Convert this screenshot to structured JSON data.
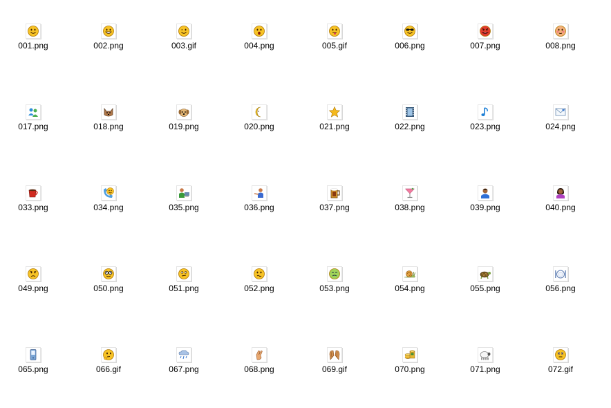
{
  "files": [
    {
      "name": "001.png",
      "icon": "smile-icon"
    },
    {
      "name": "002.png",
      "icon": "grin-icon"
    },
    {
      "name": "003.gif",
      "icon": "wink-icon"
    },
    {
      "name": "004.png",
      "icon": "surprised-icon"
    },
    {
      "name": "005.gif",
      "icon": "tongue-icon"
    },
    {
      "name": "006.png",
      "icon": "sunglasses-icon"
    },
    {
      "name": "007.png",
      "icon": "angry-red-icon"
    },
    {
      "name": "008.png",
      "icon": "blush-icon"
    },
    {
      "name": "017.png",
      "icon": "people-icon"
    },
    {
      "name": "018.png",
      "icon": "cat-icon"
    },
    {
      "name": "019.png",
      "icon": "dog-icon"
    },
    {
      "name": "020.png",
      "icon": "moon-icon"
    },
    {
      "name": "021.png",
      "icon": "star-icon"
    },
    {
      "name": "022.png",
      "icon": "film-icon"
    },
    {
      "name": "023.png",
      "icon": "music-note-icon"
    },
    {
      "name": "024.png",
      "icon": "envelope-icon"
    },
    {
      "name": "033.png",
      "icon": "coffee-cup-icon"
    },
    {
      "name": "034.png",
      "icon": "phone-smiley-icon"
    },
    {
      "name": "035.png",
      "icon": "person-computer-icon"
    },
    {
      "name": "036.png",
      "icon": "person-pointing-icon"
    },
    {
      "name": "037.png",
      "icon": "beer-mug-icon"
    },
    {
      "name": "038.png",
      "icon": "cocktail-icon"
    },
    {
      "name": "039.png",
      "icon": "boy-icon"
    },
    {
      "name": "040.png",
      "icon": "girl-icon"
    },
    {
      "name": "049.png",
      "icon": "sad-icon"
    },
    {
      "name": "050.png",
      "icon": "nerd-glasses-icon"
    },
    {
      "name": "051.png",
      "icon": "eye-roll-icon"
    },
    {
      "name": "052.png",
      "icon": "confused-icon"
    },
    {
      "name": "053.png",
      "icon": "sick-icon"
    },
    {
      "name": "054.png",
      "icon": "snail-icon"
    },
    {
      "name": "055.png",
      "icon": "turtle-icon"
    },
    {
      "name": "056.png",
      "icon": "plate-icon"
    },
    {
      "name": "065.png",
      "icon": "mobile-phone-icon"
    },
    {
      "name": "066.gif",
      "icon": "thinking-icon"
    },
    {
      "name": "067.png",
      "icon": "rain-cloud-icon"
    },
    {
      "name": "068.png",
      "icon": "fingers-crossed-icon"
    },
    {
      "name": "069.gif",
      "icon": "clapping-hands-icon"
    },
    {
      "name": "070.png",
      "icon": "coins-icon"
    },
    {
      "name": "071.png",
      "icon": "sheep-icon"
    },
    {
      "name": "072.gif",
      "icon": "smiley-face-icon"
    }
  ]
}
